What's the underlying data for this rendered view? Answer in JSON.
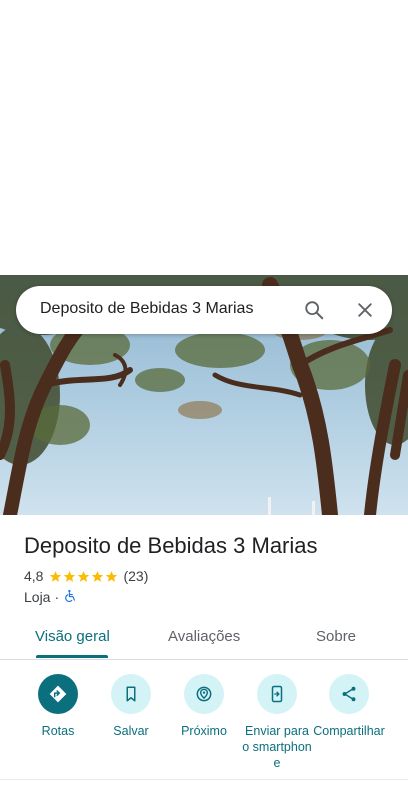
{
  "search": {
    "query": "Deposito de Bebidas 3 Marias"
  },
  "place": {
    "title": "Deposito de Bebidas 3 Marias",
    "rating": "4,8",
    "stars": 5,
    "review_count": "(23)",
    "category": "Loja",
    "separator": "·"
  },
  "tabs": [
    {
      "label": "Visão geral",
      "active": true
    },
    {
      "label": "Avaliações",
      "active": false
    },
    {
      "label": "Sobre",
      "active": false
    }
  ],
  "actions": [
    {
      "label": "Rotas",
      "icon": "directions-icon"
    },
    {
      "label": "Salvar",
      "icon": "bookmark-icon"
    },
    {
      "label": "Próximo",
      "icon": "nearby-icon"
    },
    {
      "label": "Enviar para o smartphone",
      "icon": "send-to-phone-icon"
    },
    {
      "label": "Compartilhar",
      "icon": "share-icon"
    }
  ],
  "colors": {
    "accent": "#0b6f7d",
    "action_bg": "#d4f3f7",
    "star": "#fbbc04",
    "accessibility": "#1a73e8"
  }
}
